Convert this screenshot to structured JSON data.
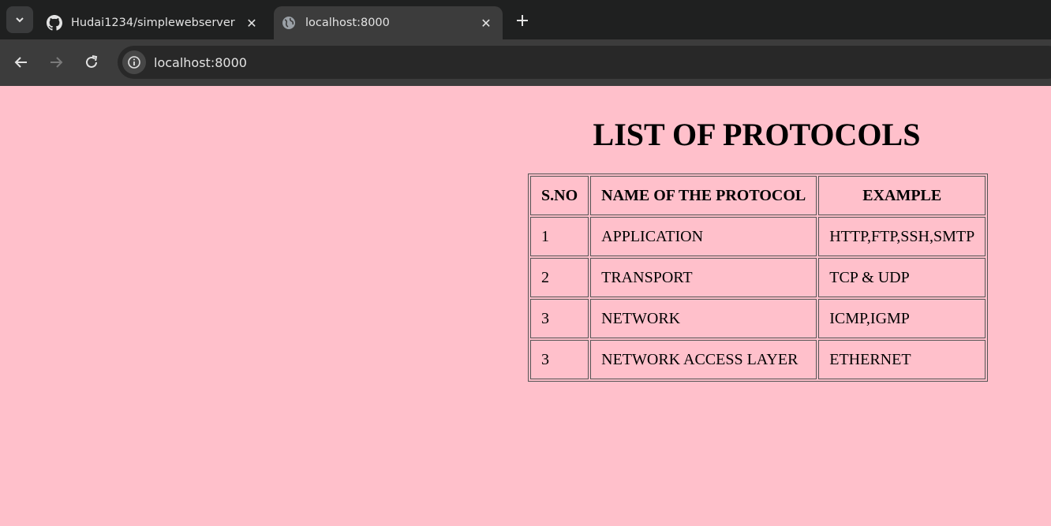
{
  "browser": {
    "tabs": [
      {
        "title": "Hudai1234/simplewebserver",
        "icon": "github-icon",
        "active": false
      },
      {
        "title": "localhost:8000",
        "icon": "globe-icon",
        "active": true
      }
    ],
    "address_bar": {
      "url": "localhost:8000"
    }
  },
  "page": {
    "background_color": "#ffc0cb",
    "heading": "LIST OF PROTOCOLS",
    "table": {
      "headers": [
        "S.NO",
        "NAME OF THE PROTOCOL",
        "EXAMPLE"
      ],
      "rows": [
        [
          "1",
          "APPLICATION",
          "HTTP,FTP,SSH,SMTP"
        ],
        [
          "2",
          "TRANSPORT",
          "TCP & UDP"
        ],
        [
          "3",
          "NETWORK",
          "ICMP,IGMP"
        ],
        [
          "3",
          "NETWORK ACCESS LAYER",
          "ETHERNET"
        ]
      ]
    }
  }
}
